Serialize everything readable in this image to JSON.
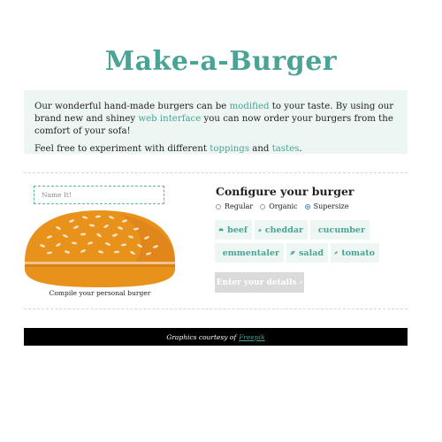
{
  "header": {
    "title": "Make-a-Burger"
  },
  "intro": {
    "p1_a": "Our wonderful hand-made burgers can be ",
    "p1_link1": "modified",
    "p1_b": " to your taste. By using our brand new and shiney ",
    "p1_link2": "web interface",
    "p1_c": " you can now order your burgers from the comfort of your sofa!",
    "p2_a": "Feel free to experiment with different ",
    "p2_link1": "toppings",
    "p2_b": " and ",
    "p2_link2": "tastes",
    "p2_c": "."
  },
  "builder": {
    "name_placeholder": "Name It!",
    "name_value": "",
    "caption": "Compile your personal burger"
  },
  "config": {
    "title": "Configure your burger",
    "sizes": [
      {
        "label": "Regular",
        "selected": false
      },
      {
        "label": "Organic",
        "selected": false
      },
      {
        "label": "Supersize",
        "selected": true
      }
    ],
    "ingredients": [
      {
        "label": "beef",
        "icon": "cow-icon"
      },
      {
        "label": "cheddar",
        "icon": "cheese-icon"
      },
      {
        "label": "cucumber",
        "icon": "leaf-icon"
      },
      {
        "label": "emmentaler",
        "icon": "cheese-icon"
      },
      {
        "label": "salad",
        "icon": "leaf-icon"
      },
      {
        "label": "tomato",
        "icon": "leaf-icon"
      }
    ],
    "cta_label": "Enter your details ›"
  },
  "footer": {
    "text": "Graphics courtesy of",
    "link": "Freepik"
  },
  "colors": {
    "accent": "#4aa394",
    "intro_bg": "#eef6f4",
    "bun_top": "#e8921c",
    "bun_shadow": "#cf7316",
    "footer_bg": "#000000",
    "cta_bg": "#dadada"
  }
}
